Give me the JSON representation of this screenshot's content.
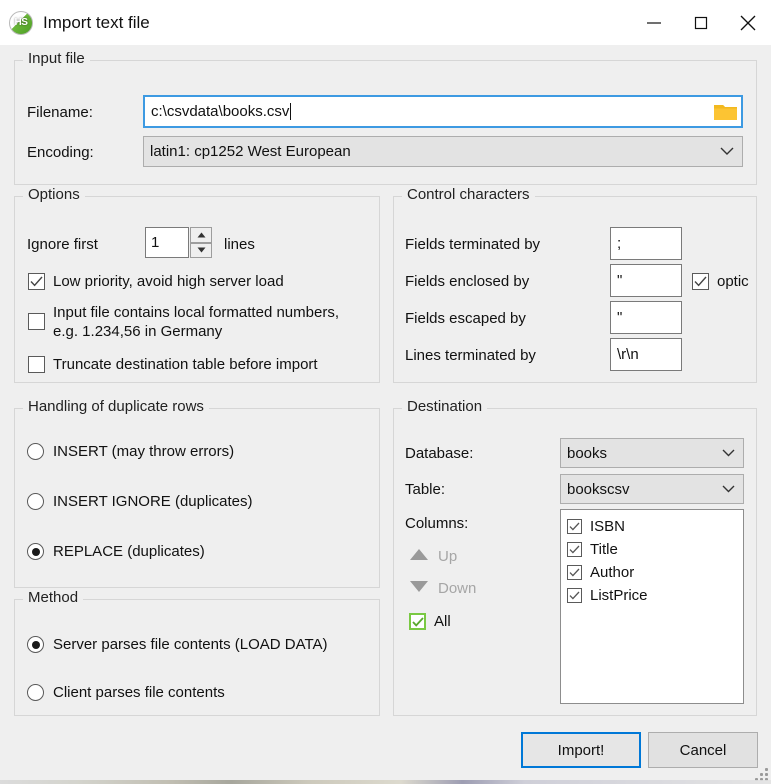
{
  "window": {
    "title": "Import text file",
    "icon": "heidisql-logo-icon",
    "icon_text": "HS",
    "minimize_label": "Minimize",
    "maximize_label": "Maximize",
    "close_label": "Close"
  },
  "input_file": {
    "legend": "Input file",
    "filename_label": "Filename:",
    "filename_value": "c:\\csvdata\\books.csv",
    "browse_icon": "folder-icon",
    "encoding_label": "Encoding:",
    "encoding_value": "latin1: cp1252 West European"
  },
  "options": {
    "legend": "Options",
    "ignore_first_label": "Ignore first",
    "ignore_first_value": "1",
    "lines_label": "lines",
    "low_priority_label": "Low priority, avoid high server load",
    "low_priority_checked": true,
    "local_numbers_label": "Input file contains local formatted numbers, e.g. 1.234,56 in Germany",
    "local_numbers_checked": false,
    "truncate_label": "Truncate destination table before import",
    "truncate_checked": false
  },
  "control_characters": {
    "legend": "Control characters",
    "fields_terminated_label": "Fields terminated by",
    "fields_terminated_value": ";",
    "fields_enclosed_label": "Fields enclosed by",
    "fields_enclosed_value": "\"",
    "optionally_label": "optic",
    "optionally_checked": true,
    "fields_escaped_label": "Fields escaped by",
    "fields_escaped_value": "\"",
    "lines_terminated_label": "Lines terminated by",
    "lines_terminated_value": "\\r\\n"
  },
  "duplicates": {
    "legend": "Handling of duplicate rows",
    "options": [
      {
        "label": "INSERT (may throw errors)",
        "selected": false
      },
      {
        "label": "INSERT IGNORE (duplicates)",
        "selected": false
      },
      {
        "label": "REPLACE (duplicates)",
        "selected": true
      }
    ]
  },
  "method": {
    "legend": "Method",
    "options": [
      {
        "label": "Server parses file contents (LOAD DATA)",
        "selected": true
      },
      {
        "label": "Client parses file contents",
        "selected": false
      }
    ]
  },
  "destination": {
    "legend": "Destination",
    "database_label": "Database:",
    "database_value": "books",
    "table_label": "Table:",
    "table_value": "bookscsv",
    "columns_label": "Columns:",
    "up_label": "Up",
    "down_label": "Down",
    "all_label": "All",
    "all_checked": true,
    "columns": [
      {
        "label": "ISBN",
        "checked": true
      },
      {
        "label": "Title",
        "checked": true
      },
      {
        "label": "Author",
        "checked": true
      },
      {
        "label": "ListPrice",
        "checked": true
      }
    ]
  },
  "footer": {
    "import_label": "Import!",
    "cancel_label": "Cancel"
  },
  "colors": {
    "accent_focus": "#0078d7",
    "input_focus_border": "#3d9ae2",
    "folder_icon": "#fcc433",
    "all_checkbox_green": "#7ac943",
    "dialog_background": "#efefef"
  }
}
